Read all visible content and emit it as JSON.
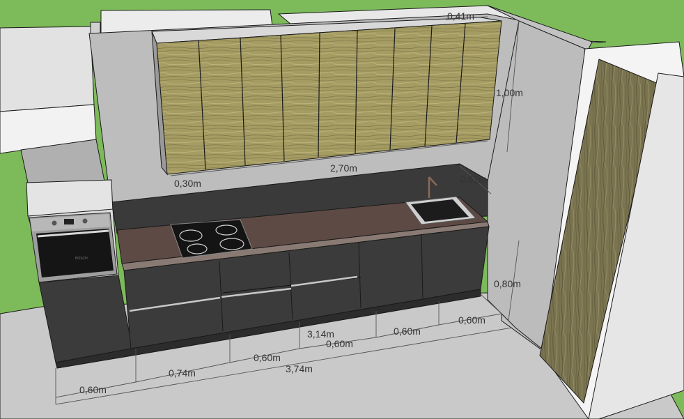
{
  "colors": {
    "ground": "#7dbb5a",
    "floor": "#c9c9c9",
    "wall": "#bdbdbd",
    "wall_light": "#d4d4d4",
    "white_block": "#ececec",
    "backsplash": "#3a3a3a",
    "countertop": "#5e4a44",
    "cabinet": "#3b3b3b",
    "cabinet_edge": "#111111",
    "wood": "#a59c63",
    "wood_dark": "#6d6848",
    "steel": "#c8c8c8"
  },
  "dimensions": {
    "upper_depth": "0,41m",
    "upper_height": "1,00m",
    "upper_offset": "0,30m",
    "upper_width": "2,70m",
    "backsplash_height": "0,61m",
    "base_height": "0,80m",
    "base_total": "3,14m",
    "segment_1": "0,60m",
    "segment_2": "0,74m",
    "segment_3": "0,60m",
    "segment_4": "0,60m",
    "segment_5": "0,60m",
    "segment_6": "0,60m",
    "total_width": "3,74m"
  },
  "appliances": {
    "oven_brand": "BOSCH"
  }
}
